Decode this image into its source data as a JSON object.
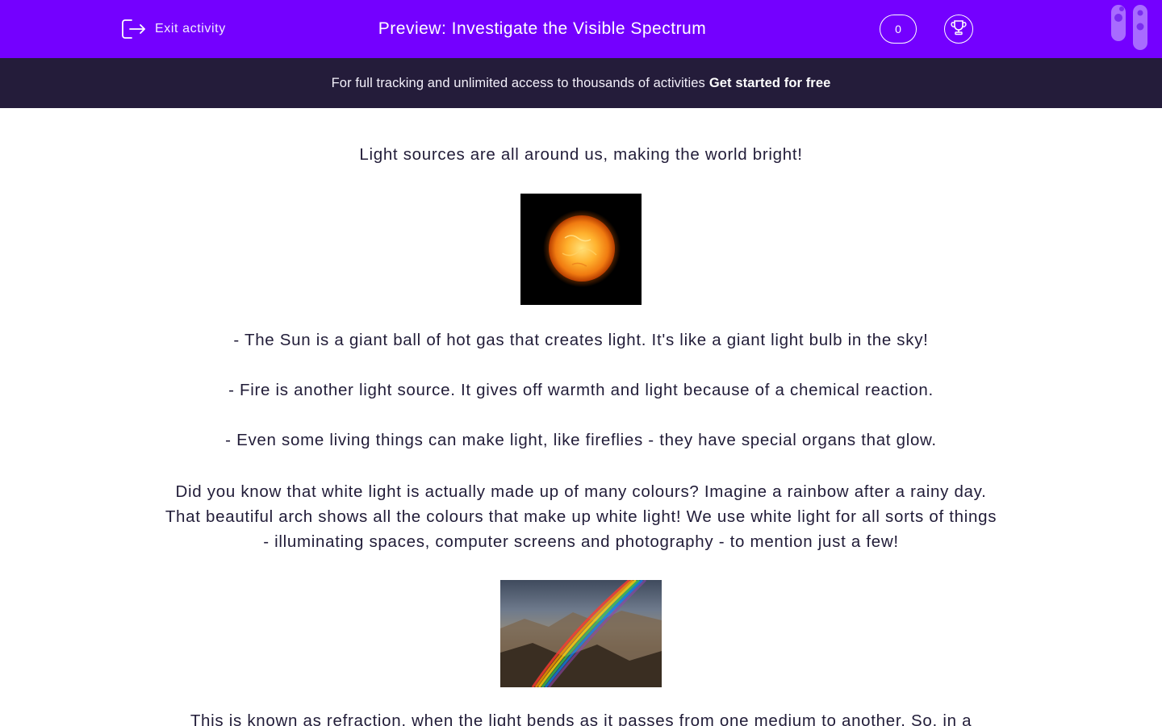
{
  "header": {
    "exit_label": "Exit activity",
    "title": "Preview: Investigate the Visible Spectrum",
    "score": "0",
    "exit_icon": "exit-icon",
    "trophy_icon": "trophy-icon",
    "logo_icon": "logo-icon"
  },
  "banner": {
    "text": "For full tracking and unlimited access to thousands of activities",
    "cta": "Get started for free"
  },
  "content": {
    "intro": "Light sources are all around us, making the world bright!",
    "bullets": [
      "-  The Sun is a giant ball of hot gas that creates light. It's like a giant light bulb in the sky!",
      "-  Fire is another light source. It gives off warmth and light because of a chemical reaction.",
      "-  Even some living things can make light, like fireflies - they have special organs that glow."
    ],
    "paragraph_lines": [
      "Did you know that white light is actually made up of many colours? Imagine a rainbow after a rainy day.",
      "That beautiful arch shows all the colours that make up white light! We use white light for all sorts of things",
      "-  illuminating spaces, computer screens and photography - to mention just a few!"
    ],
    "refraction_line": "This is known as refraction, when the light bends as it passes from one medium to another. So, in a"
  },
  "colors": {
    "topbar": "#7400ff",
    "banner": "#241c3a",
    "text": "#211c38"
  }
}
